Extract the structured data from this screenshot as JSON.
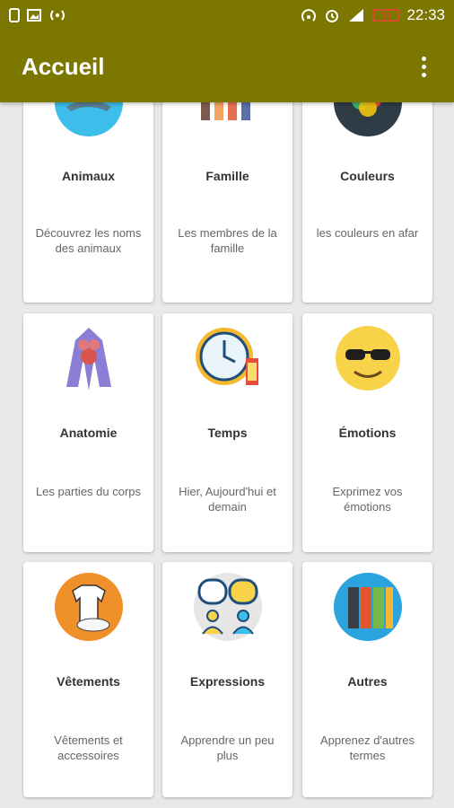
{
  "status": {
    "time": "22:33",
    "battery": "10"
  },
  "appbar": {
    "title": "Accueil"
  },
  "cards": [
    {
      "title": "Animaux",
      "desc": "Découvrez les noms des animaux",
      "icon": "shark-icon"
    },
    {
      "title": "Famille",
      "desc": "Les membres de la famille",
      "icon": "family-icon"
    },
    {
      "title": "Couleurs",
      "desc": "les couleurs en afar",
      "icon": "color-circles-icon"
    },
    {
      "title": "Anatomie",
      "desc": "Les parties du corps",
      "icon": "anatomy-icon"
    },
    {
      "title": "Temps",
      "desc": "Hier, Aujourd'hui et demain",
      "icon": "clock-icon"
    },
    {
      "title": "Émotions",
      "desc": "Exprimez vos émotions",
      "icon": "emoji-sunglasses-icon"
    },
    {
      "title": "Vêtements",
      "desc": "Vêtements et accessoires",
      "icon": "clothes-icon"
    },
    {
      "title": "Expressions",
      "desc": "Apprendre un peu plus",
      "icon": "chat-people-icon"
    },
    {
      "title": "Autres",
      "desc": "Apprenez d'autres termes",
      "icon": "binders-icon"
    }
  ]
}
